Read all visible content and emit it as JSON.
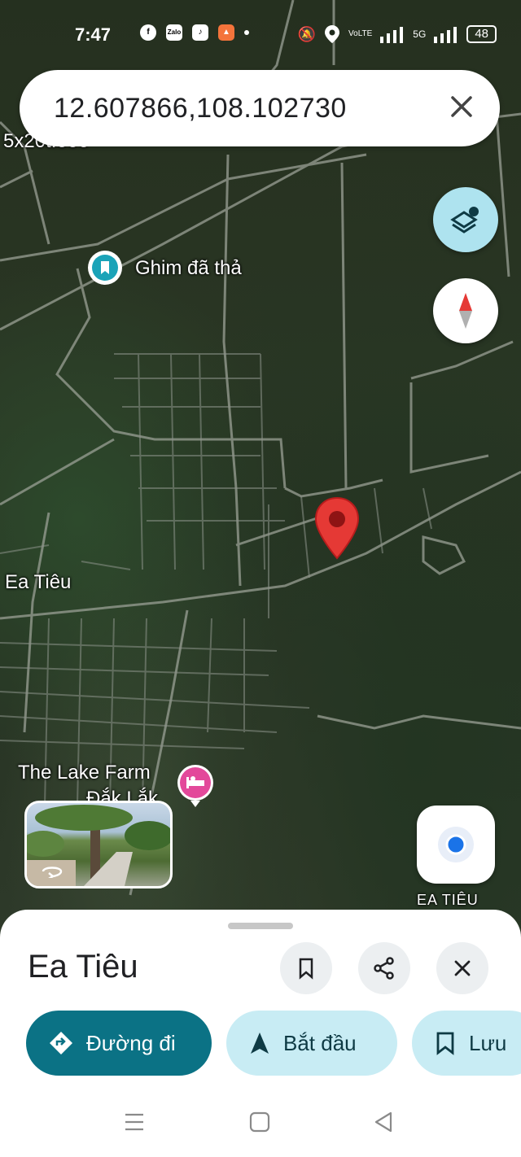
{
  "status_bar": {
    "time": "7:47",
    "apps": [
      "facebook-icon",
      "zalo-icon",
      "tiktok-icon",
      "game-icon"
    ],
    "network_type": "VoLTE",
    "signal_5g": "5G",
    "battery": "48"
  },
  "search": {
    "query": "12.607866,108.102730",
    "clear_icon": "close-icon"
  },
  "map": {
    "top_left_fragment": "5x20t.000",
    "dropped_pin_label": "Ghim đã thả",
    "town_label": "Ea Tiêu",
    "poi_name_line1": "The Lake Farm",
    "poi_name_line2": "Đắk Lắk",
    "my_location_caption": "EA TIÊU",
    "pin_color": "#e53935",
    "accent": "#1aa3b8"
  },
  "sheet": {
    "title": "Ea Tiêu",
    "save_icon": "bookmark-icon",
    "share_icon": "share-icon",
    "close_icon": "close-icon",
    "directions_label": "Đường đi",
    "start_label": "Bắt đầu",
    "save_label": "Lưu",
    "primary_color": "#0b7285",
    "chip_color": "#c8ecf4"
  }
}
